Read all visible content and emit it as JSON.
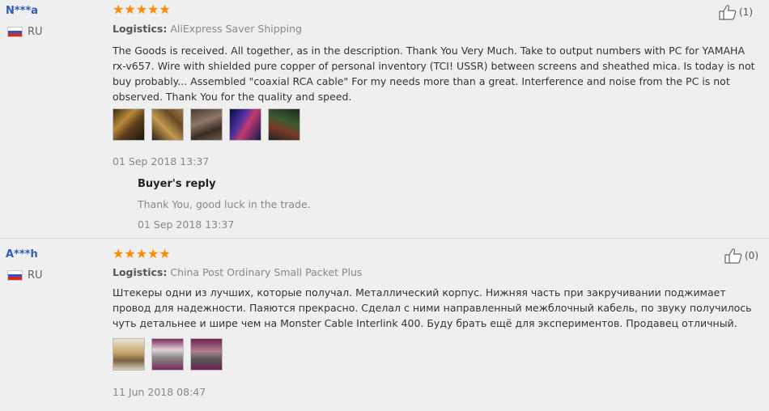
{
  "reviews": [
    {
      "user": "N***a",
      "country": "RU",
      "stars": "★★★★★",
      "logistics_label": "Logistics:",
      "logistics_value": "AliExpress Saver Shipping",
      "helpful_count": "(1)",
      "text": "The Goods is received. All together, as in the description. Thank You Very Much. Take to output numbers with PC for YAMAHA rx-v657. Wire with shielded pure copper of personal inventory (TCI! USSR) between screens and sheathed mica. Is today is not buy probably... Assembled \"coaxial RCA cable\" For my needs more than a great. Interference and noise from the PC is not observed. Thank You for the quality and speed.",
      "photo_count": 5,
      "date": "01 Sep 2018 13:37",
      "reply": {
        "title": "Buyer's reply",
        "text": "Thank You, good luck in the trade.",
        "date": "01 Sep 2018 13:37"
      }
    },
    {
      "user": "A***h",
      "country": "RU",
      "stars": "★★★★★",
      "logistics_label": "Logistics:",
      "logistics_value": "China Post Ordinary Small Packet Plus",
      "helpful_count": "(0)",
      "text": "Штекеры одни из лучших, которые получал. Металлический корпус. Нижняя часть при закручивании поджимает провод для надежности. Паяются прекрасно. Сделал с ними направленный межблочный кабель, по звуку получилось чуть детальнее и шире чем на Monster Cable Interlink 400. Буду брать ещё для экспериментов. Продавец отличный.",
      "photo_count": 3,
      "date": "11 Jun 2018 08:47"
    }
  ],
  "colors": {
    "star": "#ff8a00",
    "username": "#2b5db8",
    "background": "#efefef"
  }
}
